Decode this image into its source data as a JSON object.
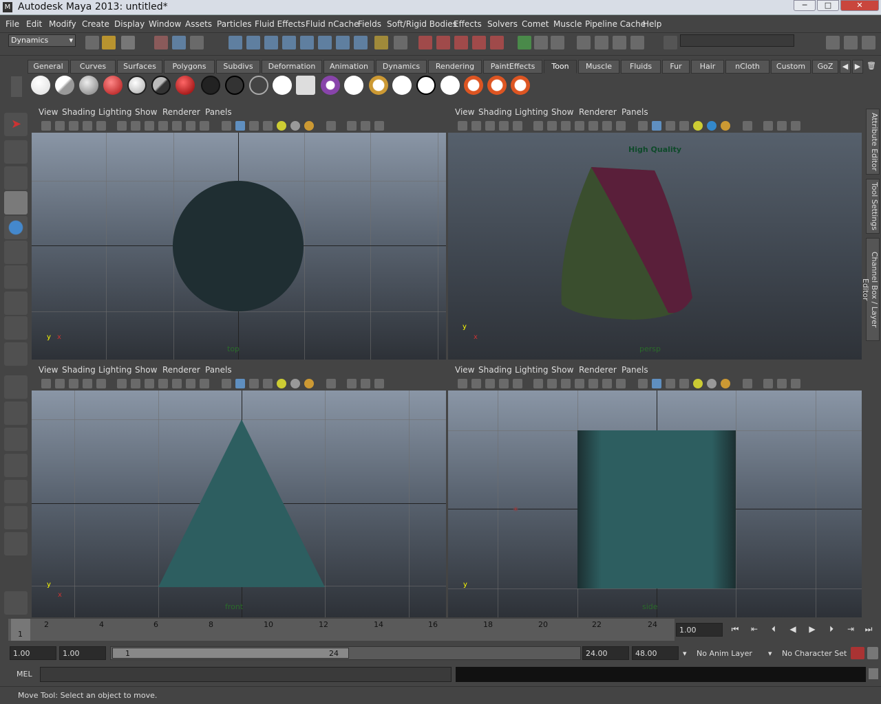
{
  "window": {
    "title": "Autodesk Maya 2013: untitled*",
    "icon": "maya-app-icon",
    "controls": [
      "─",
      "□",
      "✕"
    ]
  },
  "menubar": [
    "File",
    "Edit",
    "Modify",
    "Create",
    "Display",
    "Window",
    "Assets",
    "Particles",
    "Fluid Effects",
    "Fluid nCache",
    "Fields",
    "Soft/Rigid Bodies",
    "Effects",
    "Solvers",
    "Comet",
    "Muscle",
    "Pipeline Cache",
    "Help"
  ],
  "statusline": {
    "menuset": "Dynamics",
    "search_value": ""
  },
  "shelf": {
    "tabs": [
      "General",
      "Curves",
      "Surfaces",
      "Polygons",
      "Subdivs",
      "Deformation",
      "Animation",
      "Dynamics",
      "Rendering",
      "PaintEffects",
      "Toon",
      "Muscle",
      "Fluids",
      "Fur",
      "Hair",
      "nCloth",
      "Custom",
      "GoZ"
    ],
    "active_tab": "Toon"
  },
  "viewport_menu": [
    "View",
    "Shading",
    "Lighting",
    "Show",
    "Renderer",
    "Panels"
  ],
  "viewports": {
    "top": {
      "label": "top"
    },
    "persp": {
      "label": "persp",
      "overlay": "High Quality"
    },
    "front": {
      "label": "front"
    },
    "side": {
      "label": "side"
    }
  },
  "axes": {
    "x": "x",
    "y": "y"
  },
  "timeline": {
    "ticks": [
      "2",
      "4",
      "6",
      "8",
      "10",
      "12",
      "14",
      "16",
      "18",
      "20",
      "22",
      "24"
    ],
    "current_marker": "1",
    "current_frame": "1.00"
  },
  "range": {
    "start": "1.00",
    "playback_start": "1.00",
    "slider_start": "1",
    "slider_end": "24",
    "playback_end": "24.00",
    "end": "48.00",
    "anim_layer": "No Anim Layer",
    "character_set": "No Character Set"
  },
  "mel": {
    "label": "MEL",
    "value": ""
  },
  "help_line": "Move Tool: Select an object to move.",
  "right_tabs": [
    "Attribute Editor",
    "Tool Settings",
    "Channel Box / Layer Editor"
  ],
  "colors": {
    "ui_bg": "#444444",
    "viewport_top": "#8a96a6",
    "viewport_bottom": "#2d3137",
    "object_teal": "#2d5e60",
    "persp_red": "#5a1f3a",
    "persp_green": "#3a4e2e"
  }
}
